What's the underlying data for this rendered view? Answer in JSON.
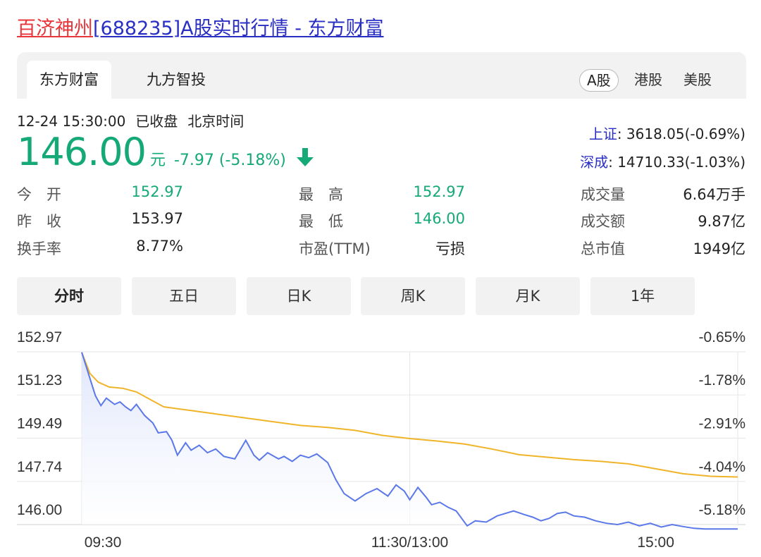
{
  "title": {
    "name_link": "百济神州",
    "rest_link": "[688235]A股实时行情 - 东方财富"
  },
  "tabs": [
    {
      "label": "东方财富",
      "active": true
    },
    {
      "label": "九方智投",
      "active": false
    }
  ],
  "markets": [
    {
      "label": "A股",
      "active": true
    },
    {
      "label": "港股",
      "active": false
    },
    {
      "label": "美股",
      "active": false
    }
  ],
  "quote": {
    "datetime": "12-24 15:30:00",
    "status": "已收盘",
    "timezone": "北京时间",
    "price": "146.00",
    "unit": "元",
    "change": "-7.97 (-5.18%)",
    "direction_icon": "down-arrow-icon",
    "down_color": "#14a976"
  },
  "indices": [
    {
      "name": "上证",
      "value": ": 3618.05(-0.69%)"
    },
    {
      "name": "深成",
      "value": ": 14710.33(-1.03%)"
    }
  ],
  "stats": {
    "open": {
      "label": "今　开",
      "value": "152.97"
    },
    "prev_close": {
      "label": "昨　收",
      "value": "153.97"
    },
    "turnover_rate": {
      "label": "换手率",
      "value": "8.77%"
    },
    "high": {
      "label": "最　高",
      "value": "152.97"
    },
    "low": {
      "label": "最　低",
      "value": "146.00"
    },
    "pe": {
      "label": "市盈(TTM)",
      "value": "亏损"
    },
    "volume": {
      "label": "成交量",
      "value": "6.64万手"
    },
    "amount": {
      "label": "成交额",
      "value": "9.87亿"
    },
    "market_cap": {
      "label": "总市值",
      "value": "1949亿"
    }
  },
  "periods": [
    {
      "label": "分时",
      "active": true
    },
    {
      "label": "五日",
      "active": false
    },
    {
      "label": "日K",
      "active": false
    },
    {
      "label": "周K",
      "active": false
    },
    {
      "label": "月K",
      "active": false
    },
    {
      "label": "1年",
      "active": false
    }
  ],
  "chart_data": {
    "type": "line",
    "y_ticks": [
      "152.97",
      "151.23",
      "149.49",
      "147.74",
      "146.00"
    ],
    "y_right_ticks": [
      "-0.65%",
      "-1.78%",
      "-2.91%",
      "-4.04%",
      "-5.18%"
    ],
    "x_ticks": [
      "09:30",
      "11:30/13:00",
      "15:00"
    ],
    "ylim": [
      146.0,
      152.97
    ],
    "xlim": [
      0,
      240
    ],
    "grid": true,
    "colors": {
      "price": "#5b78e8",
      "avg": "#f0b429",
      "fill": "#dfe6fb",
      "grid": "#e6e6e6"
    },
    "series": [
      {
        "key": "price",
        "x": [
          0,
          3,
          5,
          7,
          9,
          12,
          14,
          16,
          18,
          20,
          23,
          26,
          28,
          31,
          33,
          35,
          38,
          40,
          43,
          46,
          49,
          52,
          56,
          60,
          63,
          65,
          68,
          72,
          74,
          77,
          80,
          83,
          86,
          90,
          93,
          96,
          100,
          104,
          108,
          112,
          115,
          118,
          120,
          123,
          126,
          128,
          131,
          134,
          137,
          141,
          144,
          148,
          152,
          155,
          158,
          162,
          165,
          168,
          171,
          174,
          177,
          180,
          184,
          188,
          192,
          196,
          200,
          204,
          208,
          212,
          216,
          220,
          224,
          228,
          232,
          236,
          240
        ],
        "values": [
          152.95,
          151.9,
          151.2,
          150.8,
          151.1,
          150.85,
          150.95,
          150.75,
          150.6,
          150.85,
          150.4,
          150.1,
          149.7,
          149.75,
          149.4,
          148.8,
          149.3,
          149.0,
          149.2,
          148.9,
          149.05,
          148.75,
          148.65,
          149.4,
          148.8,
          148.6,
          148.9,
          148.65,
          148.75,
          148.55,
          148.8,
          148.7,
          148.85,
          148.5,
          147.8,
          147.25,
          146.95,
          147.25,
          147.45,
          147.15,
          147.6,
          147.35,
          147.0,
          147.5,
          147.1,
          146.8,
          146.9,
          146.7,
          146.55,
          145.95,
          146.15,
          146.1,
          146.35,
          146.45,
          146.55,
          146.4,
          146.3,
          146.15,
          146.25,
          146.45,
          146.5,
          146.35,
          146.3,
          146.15,
          146.05,
          146.0,
          146.1,
          145.95,
          146.05,
          145.9,
          146.0,
          145.92,
          145.85,
          145.82,
          145.82,
          145.82,
          145.82
        ]
      },
      {
        "key": "avg",
        "x": [
          0,
          3,
          6,
          10,
          15,
          20,
          25,
          30,
          40,
          50,
          60,
          70,
          80,
          90,
          100,
          110,
          120,
          130,
          140,
          150,
          160,
          170,
          180,
          190,
          200,
          210,
          220,
          230,
          240
        ],
        "values": [
          152.95,
          152.1,
          151.75,
          151.55,
          151.5,
          151.35,
          151.05,
          150.75,
          150.6,
          150.45,
          150.3,
          150.15,
          150.0,
          149.92,
          149.8,
          149.6,
          149.47,
          149.37,
          149.25,
          149.05,
          148.82,
          148.72,
          148.62,
          148.55,
          148.45,
          148.25,
          148.05,
          147.95,
          147.92
        ]
      }
    ]
  }
}
